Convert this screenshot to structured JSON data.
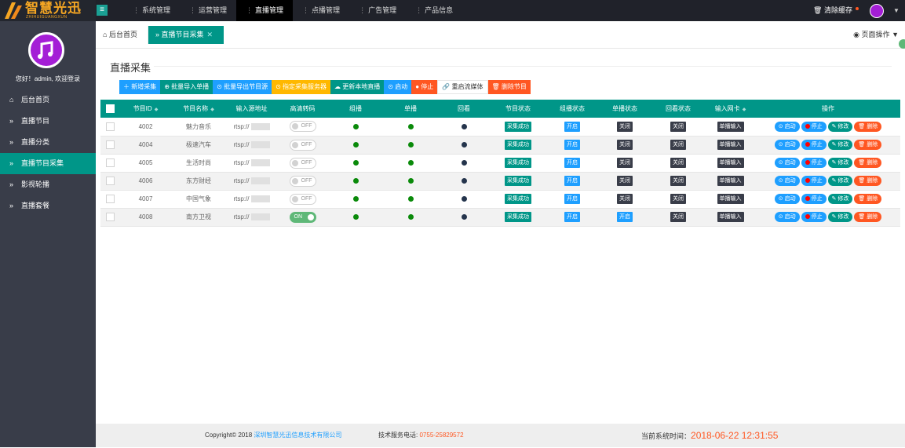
{
  "brand": {
    "name": "智慧光迅",
    "sub": "ZHIHUIGUANGXUN"
  },
  "topnav": {
    "items": [
      "系统管理",
      "运营管理",
      "直播管理",
      "点播管理",
      "广告管理",
      "产品信息"
    ],
    "active_index": 2,
    "clear_cache": "清除缓存"
  },
  "sidebar": {
    "welcome": "您好！admin, 欢迎登录",
    "items": [
      {
        "label": "后台首页",
        "icon": "home-icon"
      },
      {
        "label": "直播节目",
        "icon": "double-chevron-icon"
      },
      {
        "label": "直播分类",
        "icon": "double-chevron-icon"
      },
      {
        "label": "直播节目采集",
        "icon": "double-chevron-icon"
      },
      {
        "label": "影视轮播",
        "icon": "double-chevron-icon"
      },
      {
        "label": "直播套餐",
        "icon": "double-chevron-icon"
      }
    ],
    "active_index": 3
  },
  "tabs": {
    "home": "后台首页",
    "current": "直播节目采集",
    "page_ops": "页面操作"
  },
  "main": {
    "title": "直播采集",
    "toolbar": {
      "new": "新增采集",
      "import": "批量导入单播",
      "export": "批量导出节目源",
      "server": "指定采集服务器",
      "update": "更新本地直播",
      "start": "启动",
      "stop": "停止",
      "reset": "重启流媒体",
      "delete": "删除节目"
    },
    "columns": [
      "节目ID",
      "节目名称",
      "输入源地址",
      "高清转码",
      "组播",
      "单播",
      "回看",
      "节目状态",
      "组播状态",
      "单播状态",
      "回看状态",
      "输入网卡",
      "操作"
    ],
    "rows": [
      {
        "id": "4002",
        "name": "魅力音乐",
        "src": "rtsp://",
        "hd": "OFF",
        "prog_status": "采集成功",
        "mcast_status": "开启",
        "ucast_status": "关闭",
        "replay_status": "关闭",
        "nic": "单播输入"
      },
      {
        "id": "4004",
        "name": "极速汽车",
        "src": "rtsp://",
        "hd": "OFF",
        "prog_status": "采集成功",
        "mcast_status": "开启",
        "ucast_status": "关闭",
        "replay_status": "关闭",
        "nic": "单播输入"
      },
      {
        "id": "4005",
        "name": "生活时尚",
        "src": "rtsp://",
        "hd": "OFF",
        "prog_status": "采集成功",
        "mcast_status": "开启",
        "ucast_status": "关闭",
        "replay_status": "关闭",
        "nic": "单播输入"
      },
      {
        "id": "4006",
        "name": "东方财经",
        "src": "rtsp://",
        "hd": "OFF",
        "prog_status": "采集成功",
        "mcast_status": "开启",
        "ucast_status": "关闭",
        "replay_status": "关闭",
        "nic": "单播输入"
      },
      {
        "id": "4007",
        "name": "中国气象",
        "src": "rtsp://",
        "hd": "OFF",
        "prog_status": "采集成功",
        "mcast_status": "开启",
        "ucast_status": "关闭",
        "replay_status": "关闭",
        "nic": "单播输入"
      },
      {
        "id": "4008",
        "name": "南方卫视",
        "src": "rtsp://",
        "hd": "ON",
        "prog_status": "采集成功",
        "mcast_status": "开启",
        "ucast_status": "开启",
        "replay_status": "关闭",
        "nic": "单播输入"
      }
    ],
    "row_actions": {
      "start": "启动",
      "stop": "停止",
      "edit": "修改",
      "delete": "删除"
    }
  },
  "footer": {
    "copyright": "Copyright© 2018",
    "company": "深圳智慧光迅信息技术有限公司",
    "tel_label": "技术服务电话:",
    "tel": "0755-25829572",
    "time_label": "当前系统时间：",
    "time": "2018-06-22 12:31:55"
  },
  "colors": {
    "accent": "#009688",
    "blue": "#1e9fff",
    "danger": "#ff5722",
    "warn": "#ffb800",
    "sidebar": "#393d49"
  }
}
